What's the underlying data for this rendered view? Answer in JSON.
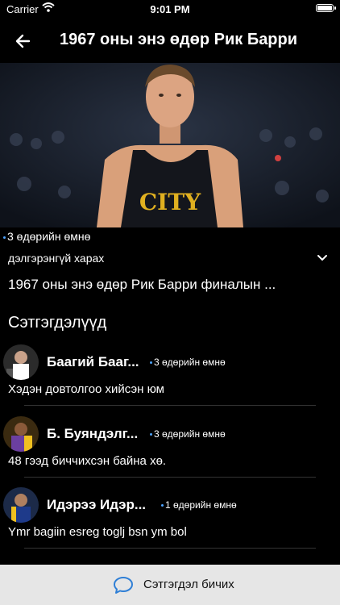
{
  "status_bar": {
    "carrier": "Carrier",
    "time": "9:01 PM"
  },
  "nav": {
    "title": "1967 оны энэ өдөр Рик Барри"
  },
  "article": {
    "time_ago": "3 өдөрийн өмнө",
    "details_label": "дэлгэрэнгүй харах",
    "title": "1967 оны энэ өдөр Рик Барри финалын ..."
  },
  "comments_heading": "Сэтгэгдэлүүд",
  "comments": [
    {
      "name": "Баагий Бааг...",
      "time": "3 өдөрийн өмнө",
      "text": "Хэдэн довтолгоо хийсэн юм"
    },
    {
      "name": "Б. Буяндэлг...",
      "time": "3 өдөрийн өмнө",
      "text": "48 гээд биччихсэн байна хө."
    },
    {
      "name": "Идэрээ Идэр...",
      "time": "1 өдөрийн өмнө",
      "text": "Ymr bagiin esreg toglj bsn ym bol"
    }
  ],
  "bottom_bar": {
    "label": "Сэтгэгдэл бичих"
  },
  "colors": {
    "accent": "#4da3ff",
    "background": "#000000",
    "bottom_bar": "#e6e6e6"
  },
  "icons": [
    "wifi-icon",
    "battery-icon",
    "back-arrow-icon",
    "chevron-down-icon",
    "chat-bubble-icon"
  ]
}
